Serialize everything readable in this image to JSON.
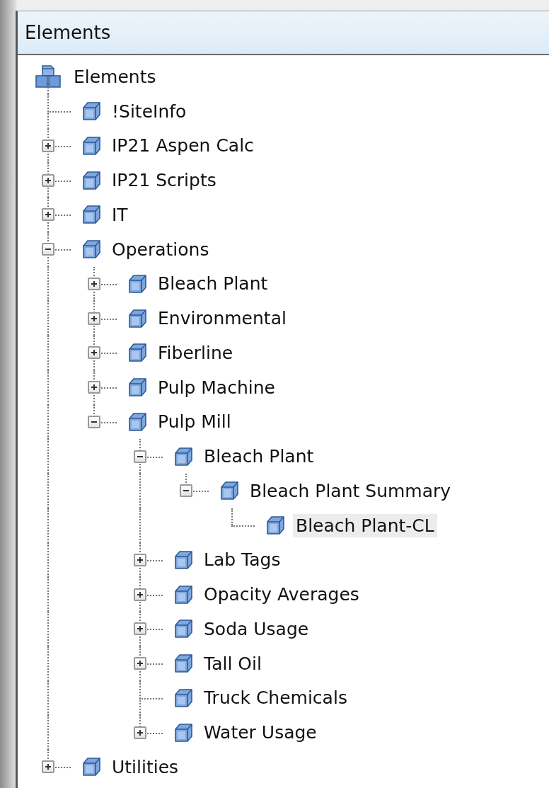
{
  "panel": {
    "title": "Elements"
  },
  "tree": {
    "label": "Elements",
    "kind": "root",
    "selected": false,
    "children": [
      {
        "label": "!SiteInfo",
        "kind": "element",
        "selected": false
      },
      {
        "label": "IP21 Aspen Calc",
        "kind": "element",
        "selected": false,
        "expanded": false
      },
      {
        "label": "IP21 Scripts",
        "kind": "element",
        "selected": false,
        "expanded": false
      },
      {
        "label": "IT",
        "kind": "element",
        "selected": false,
        "expanded": false
      },
      {
        "label": "Operations",
        "kind": "element",
        "selected": false,
        "expanded": true,
        "children": [
          {
            "label": "Bleach Plant",
            "kind": "element",
            "selected": false,
            "expanded": false
          },
          {
            "label": "Environmental",
            "kind": "element",
            "selected": false,
            "expanded": false
          },
          {
            "label": "Fiberline",
            "kind": "element",
            "selected": false,
            "expanded": false
          },
          {
            "label": "Pulp Machine",
            "kind": "element",
            "selected": false,
            "expanded": false
          },
          {
            "label": "Pulp Mill",
            "kind": "element",
            "selected": false,
            "expanded": true,
            "children": [
              {
                "label": "Bleach Plant",
                "kind": "element",
                "selected": false,
                "expanded": true,
                "children": [
                  {
                    "label": "Bleach Plant Summary",
                    "kind": "element",
                    "selected": false,
                    "expanded": true,
                    "children": [
                      {
                        "label": "Bleach Plant-CL",
                        "kind": "element",
                        "selected": true
                      }
                    ]
                  }
                ]
              },
              {
                "label": "Lab Tags",
                "kind": "element",
                "selected": false,
                "expanded": false
              },
              {
                "label": "Opacity Averages",
                "kind": "element",
                "selected": false,
                "expanded": false
              },
              {
                "label": "Soda Usage",
                "kind": "element",
                "selected": false,
                "expanded": false
              },
              {
                "label": "Tall Oil",
                "kind": "element",
                "selected": false,
                "expanded": false
              },
              {
                "label": "Truck Chemicals",
                "kind": "element",
                "selected": false
              },
              {
                "label": "Water Usage",
                "kind": "element",
                "selected": false,
                "expanded": false
              }
            ]
          }
        ]
      },
      {
        "label": "Utilities",
        "kind": "element",
        "selected": false,
        "expanded": false
      }
    ]
  }
}
